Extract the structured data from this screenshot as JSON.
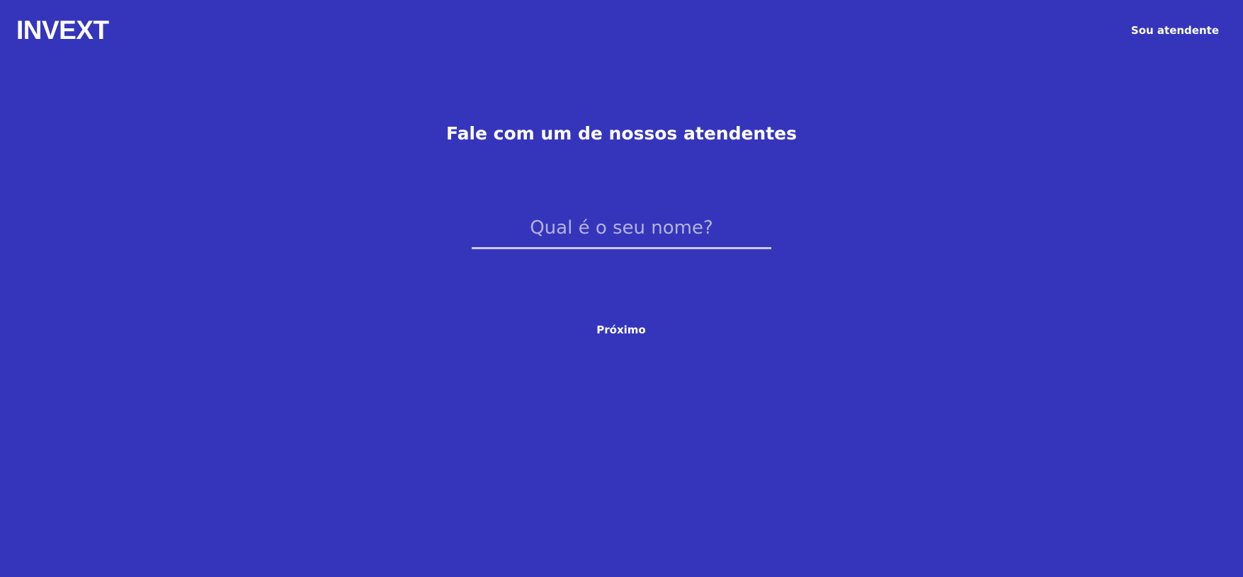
{
  "header": {
    "logo_text": "INVEXT",
    "agent_link_label": "Sou atendente"
  },
  "main": {
    "title": "Fale com um de nossos atendentes",
    "name_input": {
      "value": "",
      "placeholder": "Qual é o seu nome?"
    },
    "next_button_label": "Próximo"
  },
  "colors": {
    "background": "#3535bc",
    "text": "#ffffff",
    "input_underline": "#c9c9e6",
    "placeholder": "#b3b3d9"
  }
}
